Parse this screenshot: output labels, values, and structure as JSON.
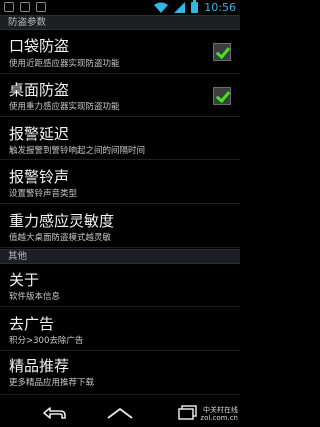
{
  "status_bar": {
    "time": "10:56"
  },
  "sections": {
    "anti_theft": "防盗参数",
    "other": "其他"
  },
  "items": [
    {
      "title": "口袋防盗",
      "summary": "使用近距感应器实现防盗功能",
      "checked": true
    },
    {
      "title": "桌面防盗",
      "summary": "使用重力感应器实现防盗功能",
      "checked": true
    },
    {
      "title": "报警延迟",
      "summary": "触发报警到警铃响起之间的间隔时间"
    },
    {
      "title": "报警铃声",
      "summary": "设置警铃声音类型"
    },
    {
      "title": "重力感应灵敏度",
      "summary": "值越大桌面防盗模式越灵敏"
    }
  ],
  "other_items": [
    {
      "title": "关于",
      "summary": "软件版本信息"
    },
    {
      "title": "去广告",
      "summary": "积分>300去除广告"
    },
    {
      "title": "精品推荐",
      "summary": "更多精品应用推荐下载"
    }
  ],
  "watermark": {
    "line1": "中关村在线",
    "line2": "zol.com.cn"
  },
  "colors": {
    "accent": "#33b5e5",
    "check": "#44e31c",
    "header_bg": "#1c1f24"
  }
}
